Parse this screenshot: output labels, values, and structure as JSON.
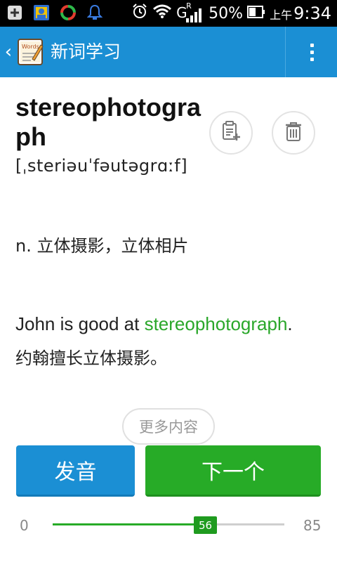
{
  "status_bar": {
    "icons": [
      "add-icon",
      "contacts-app-icon",
      "sync-icon",
      "notification-bell-icon",
      "alarm-icon",
      "wifi-icon",
      "signal-icon",
      "battery-icon"
    ],
    "network_label": "G",
    "roaming_label": "R",
    "battery_percent": "50%",
    "ampm": "上午",
    "time": "9:34"
  },
  "action_bar": {
    "back_icon": "chevron-left-icon",
    "logo_icon": "word-notebook-logo-icon",
    "title": "新词学习",
    "menu_icon": "overflow-menu-icon"
  },
  "word": {
    "text": "stereophotograph",
    "phonetic": "[ˌsteriəuˈfəutəgrɑːf]",
    "add_to_notebook_icon": "notebook-add-icon",
    "delete_icon": "trash-icon"
  },
  "definition": {
    "text": "n. 立体摄影，立体相片"
  },
  "example": {
    "prefix": "John is good at ",
    "highlight": "stereophotograph",
    "suffix": ".",
    "translation": "约翰擅长立体摄影。"
  },
  "more_button": "更多内容",
  "buttons": {
    "speak": "发音",
    "next": "下一个"
  },
  "progress": {
    "min": "0",
    "max": "85",
    "current": "56",
    "current_value": 56,
    "max_value": 85,
    "accent": "#27ab27"
  },
  "colors": {
    "primary_blue": "#1b8fd4",
    "accent_green": "#27ab27"
  }
}
